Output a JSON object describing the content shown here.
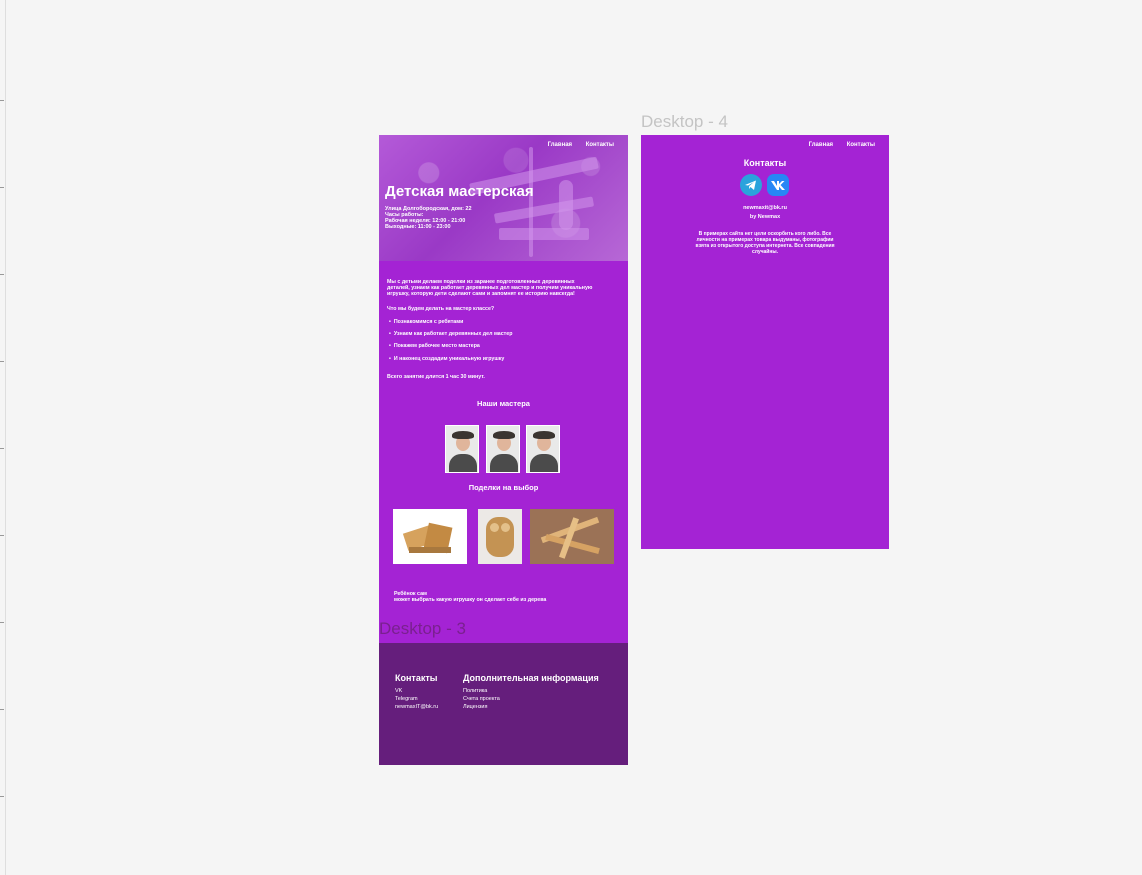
{
  "frames": {
    "desktop4_label": "Desktop - 4",
    "desktop3_label": "Desktop - 3"
  },
  "nav": {
    "home": "Главная",
    "contacts": "Контакты"
  },
  "hero": {
    "title": "Детская мастерская",
    "address": "Улица Долгобородская, дом: 22",
    "hours_title": "Часы работы:",
    "weekdays": "Рабочая неделя: 12:00 - 21:00",
    "weekends": "Выходные: 11:00 - 23:00"
  },
  "intro": "Мы с детьми делаем поделки из заранее подготовленных деревянных деталей, узнаем как работает деревянных дел мастер и получим уникальную игрушку, которую дети сделают сами и запомнят ее историю навсегда!",
  "plan_title": "Что мы будем делать на мастер классе?",
  "plan_items": [
    "Познакомимся с ребятами",
    "Узнаем как работает деревянных дел мастер",
    "Покажем рабочее место мастера",
    "И наконец создадим уникальную игрушку"
  ],
  "duration": "Всего занятие длится 1 час 30 минут.",
  "masters_title": "Наши мастера",
  "crafts_title": "Поделки на выбор",
  "choice_text_1": "Ребёнок сам",
  "choice_text_2": "может выбрать какую игрушку он сделает себе из дерева",
  "footer": {
    "contacts_title": "Контакты",
    "contacts": [
      "VK",
      "Telegram",
      "newmaxIT@bk.ru"
    ],
    "info_title": "Дополнительная информация",
    "info": [
      "Политика",
      "Счета проекта",
      "Лицензия"
    ]
  },
  "contacts_page": {
    "title": "Контакты",
    "email": "newmaxit@bk.ru",
    "by": "by Newmax",
    "disclaimer": "В примерах сайта нет цели оскорбить кого либо. Все личности на примерах товара выдуманы, фотографии взята из открытого доступа интернета. Все совпадения случайны."
  },
  "colors": {
    "frame_bg": "#a423d4",
    "footer_bg": "#651e7c",
    "telegram": "#2aa3dc",
    "vk": "#2787f5"
  },
  "icons": [
    "telegram-icon",
    "vk-icon"
  ]
}
